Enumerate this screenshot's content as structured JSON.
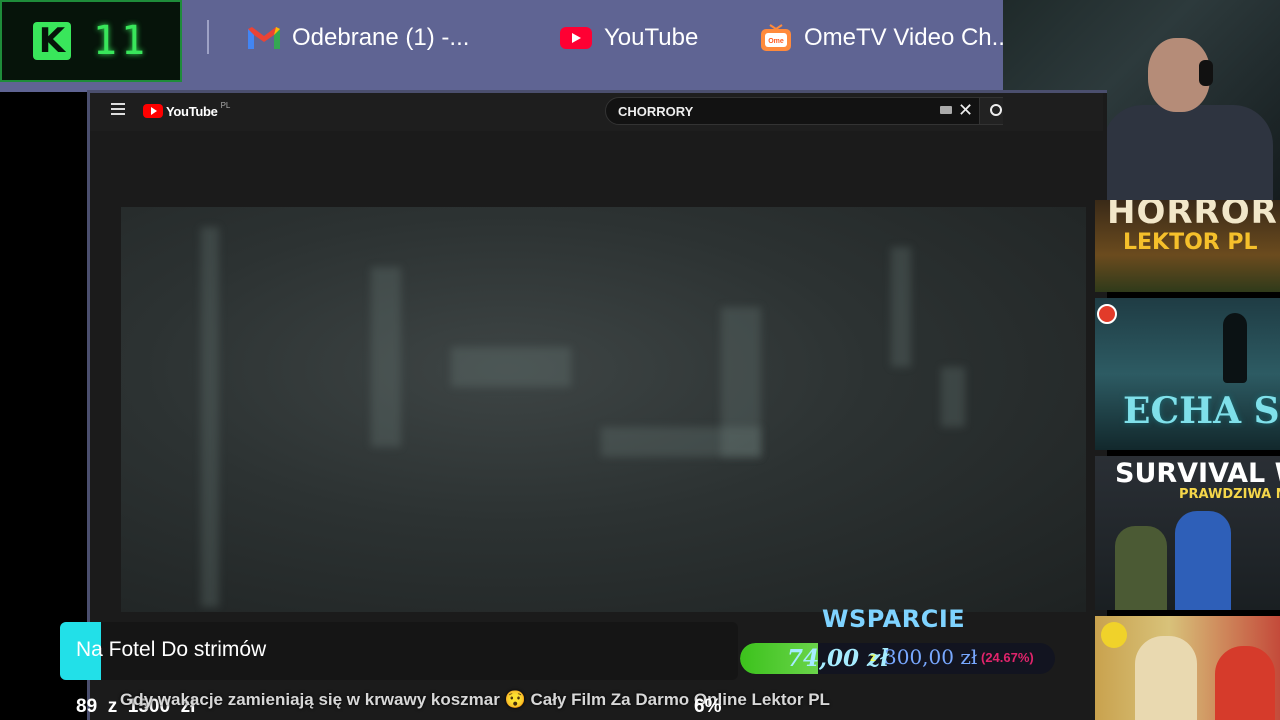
{
  "overlay_badge": {
    "letter": "K",
    "number": "11"
  },
  "bookmarks": [
    {
      "label": "Odebrane (1) -...",
      "icon": "gmail-icon"
    },
    {
      "label": "YouTube",
      "icon": "youtube-icon"
    },
    {
      "label": "OmeTV Video Ch...",
      "icon": "ometv-icon"
    }
  ],
  "youtube": {
    "logo_text": "YouTube",
    "region": "PL",
    "search_query": "CHORRORY"
  },
  "thumbnails": [
    {
      "line1": "HORROR",
      "line2": "LEKTOR PL"
    },
    {
      "line1": "ECHA STRA"
    },
    {
      "line1": "SURVIVAL W L",
      "line2": "PRAWDZIWA NOC"
    },
    {}
  ],
  "goal_overlay": {
    "title": "Na Fotel Do strimów",
    "current": "89",
    "separator": "z",
    "target": "1500",
    "currency": "zł",
    "percent": "6%"
  },
  "video_title": "Gdy wakacje zamieniają się w krwawy koszmar 😯 Cały Film Za Darmo Online Lektor PL",
  "support": {
    "title": "WSPARCIE",
    "raised": "74,00 zł",
    "separator": "z",
    "target": "300,00 zł",
    "percent_label": "(24.67%)",
    "progress_fraction": 0.2467
  },
  "colors": {
    "bookmark_bar": "#5f6493",
    "badge_green": "#39e65b",
    "goal_accent": "#22e0e8",
    "support_title": "#7fd3ff",
    "support_fill": "#3cc21c",
    "support_percent": "#e0246b"
  }
}
